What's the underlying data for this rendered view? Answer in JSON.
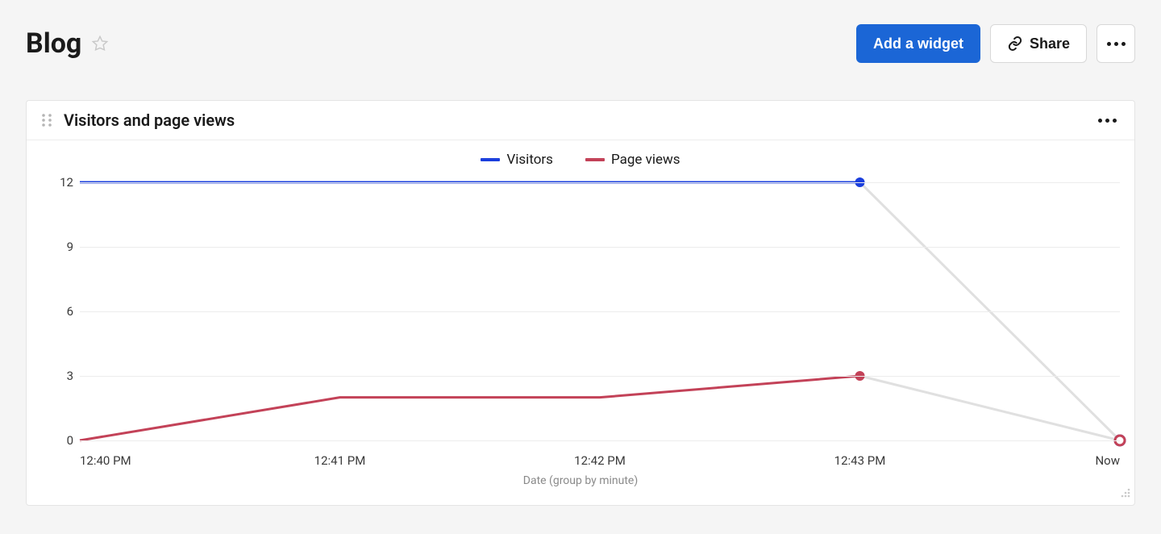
{
  "header": {
    "title": "Blog",
    "add_widget_label": "Add a widget",
    "share_label": "Share"
  },
  "widget": {
    "title": "Visitors and page views",
    "xlabel": "Date (group by minute)"
  },
  "chart_data": {
    "type": "line",
    "categories": [
      "12:40 PM",
      "12:41 PM",
      "12:42 PM",
      "12:43 PM",
      "Now"
    ],
    "series": [
      {
        "name": "Visitors",
        "color": "#1b3fdd",
        "values": [
          12,
          12,
          12,
          12,
          0
        ]
      },
      {
        "name": "Page views",
        "color": "#c34258",
        "values": [
          0,
          2,
          2,
          3,
          0
        ]
      }
    ],
    "ylim": [
      0,
      12
    ],
    "yticks": [
      0,
      3,
      6,
      9,
      12
    ],
    "highlight_index": 3,
    "xlabel": "Date (group by minute)"
  }
}
